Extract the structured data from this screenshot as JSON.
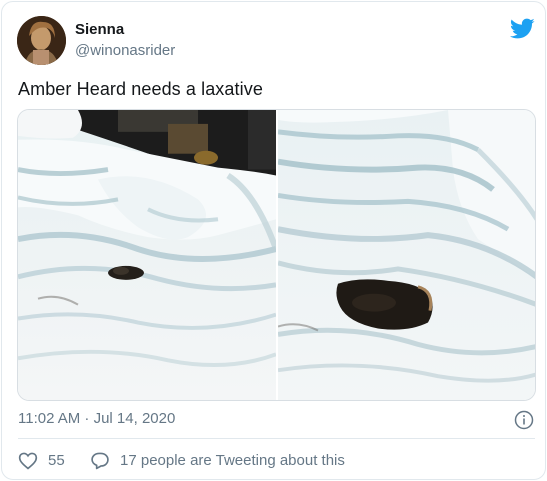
{
  "author": {
    "display_name": "Sienna",
    "handle": "@winonasrider"
  },
  "tweet": {
    "text": "Amber Heard needs a laxative",
    "timestamp": "11:02 AM · Jul 14, 2020"
  },
  "engagement": {
    "like_count": "55",
    "reply_prompt": "17 people are Tweeting about this"
  },
  "colors": {
    "twitter_blue": "#1da1f2",
    "secondary_text": "#657786",
    "primary_text": "#14171a",
    "border": "#e1e8ed"
  },
  "icons": {
    "logo": "twitter-bird-icon",
    "info": "info-icon",
    "like": "heart-icon",
    "reply": "speech-bubble-icon"
  }
}
